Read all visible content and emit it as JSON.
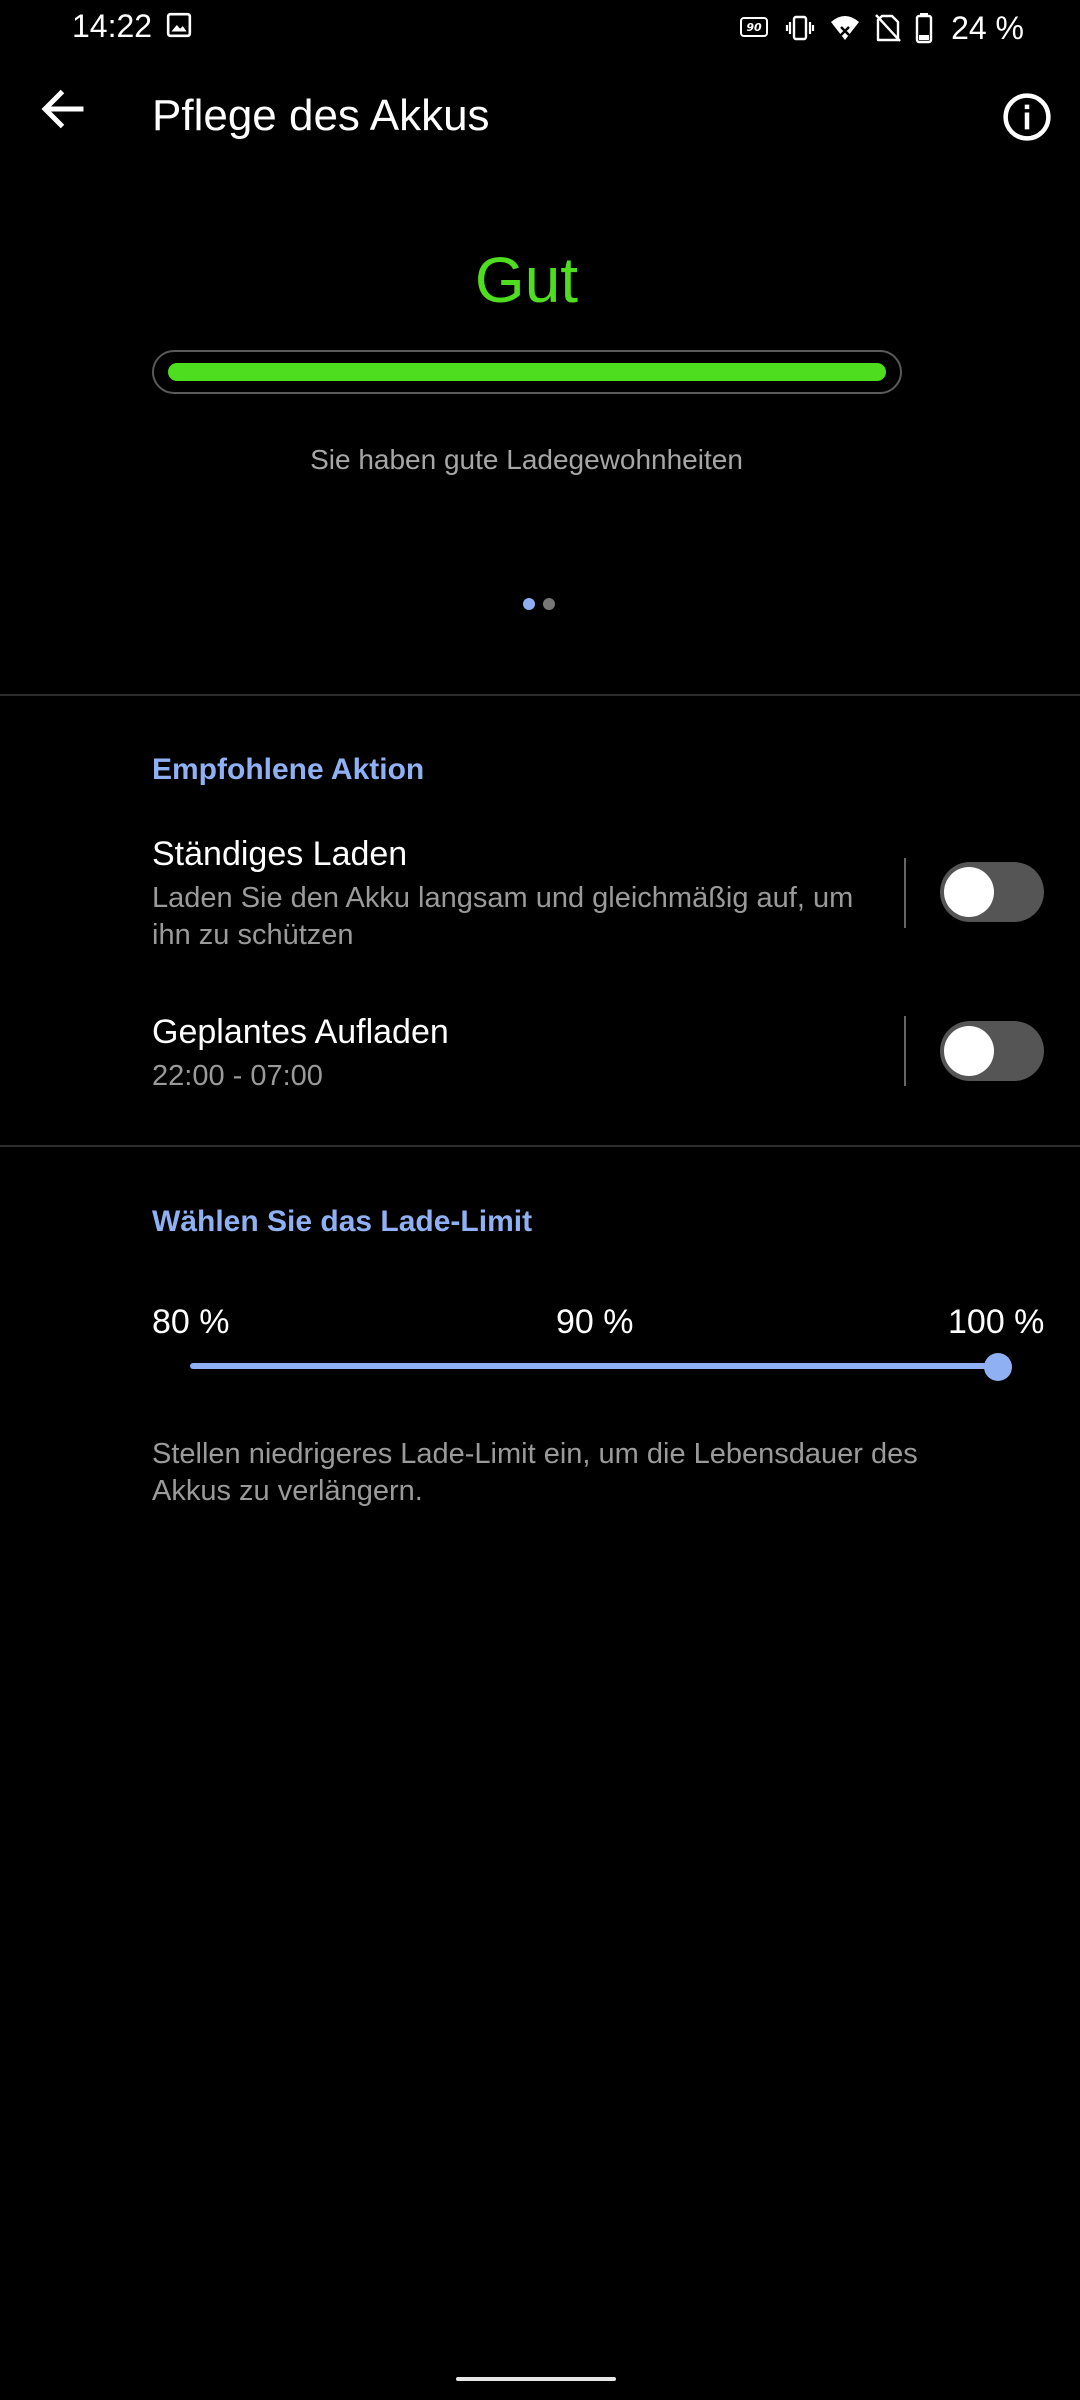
{
  "status_bar": {
    "time": "14:22",
    "battery_percent": "24 %",
    "icons": [
      "gallery-icon",
      "refresh-rate-90hz-icon",
      "vibrate-icon",
      "wifi-icon",
      "no-sim-icon",
      "battery-icon"
    ]
  },
  "app_bar": {
    "title": "Pflege des Akkus",
    "back_icon": "back-arrow-icon",
    "info_icon": "info-icon"
  },
  "health": {
    "status": "Gut",
    "status_color": "#4ede1f",
    "bar_level_percent": 100,
    "message": "Sie haben gute Ladegewohnheiten",
    "pager": {
      "pages": 2,
      "active": 0
    }
  },
  "recommended_section": {
    "title": "Empfohlene Aktion",
    "items": [
      {
        "title": "Ständiges Laden",
        "description": "Laden Sie den Akku langsam und gleichmäßig auf, um ihn zu schützen",
        "enabled": false
      },
      {
        "title": "Geplantes Aufladen",
        "description": "22:00 - 07:00",
        "enabled": false
      }
    ]
  },
  "limit_section": {
    "title": "Wählen Sie das Lade-Limit",
    "options": [
      "80 %",
      "90 %",
      "100 %"
    ],
    "selected_index": 2,
    "note": "Stellen niedrigeres Lade-Limit ein, um die Lebensdauer des Akkus zu verlängern."
  },
  "colors": {
    "accent": "#8fb0f2",
    "health_good": "#4ede1f",
    "background": "#000000"
  }
}
